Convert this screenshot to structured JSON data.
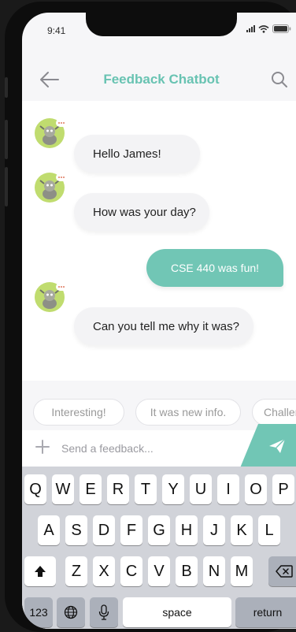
{
  "status_bar": {
    "time": "9:41"
  },
  "header": {
    "title": "Feedback Chatbot",
    "back_icon": "arrow-left-icon",
    "search_icon": "search-icon"
  },
  "messages": [
    {
      "sender": "bot",
      "text": "Hello James!"
    },
    {
      "sender": "bot",
      "text": "How was your day?"
    },
    {
      "sender": "user",
      "text": "CSE 440 was fun!"
    },
    {
      "sender": "bot",
      "text": "Can you tell me why it was?"
    }
  ],
  "quick_replies": [
    "Interesting!",
    "It was new info.",
    "Challen"
  ],
  "composer": {
    "placeholder": "Send a feedback..."
  },
  "keyboard": {
    "row1": [
      "Q",
      "W",
      "E",
      "R",
      "T",
      "Y",
      "U",
      "I",
      "O",
      "P"
    ],
    "row2": [
      "A",
      "S",
      "D",
      "F",
      "G",
      "H",
      "J",
      "K",
      "L"
    ],
    "row3": [
      "Z",
      "X",
      "C",
      "V",
      "B",
      "N",
      "M"
    ],
    "numbers_label": "123",
    "space_label": "space",
    "return_label": "return"
  },
  "colors": {
    "accent": "#71c6b5",
    "title": "#68c3b2",
    "avatar": "#c0dc6f"
  }
}
